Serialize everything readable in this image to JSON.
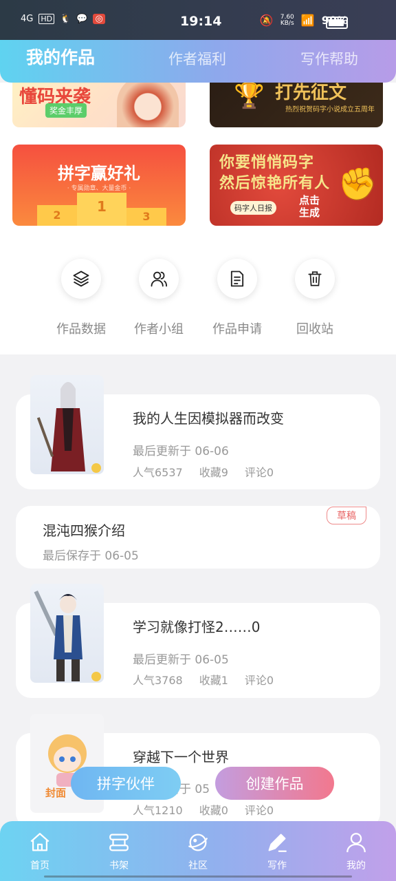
{
  "status_bar": {
    "time": "19:14",
    "network": "4G",
    "hd": "HD",
    "speed": "7.60",
    "speed_unit": "KB/s",
    "battery": "90%"
  },
  "header": {
    "tabs": [
      {
        "label": "我的作品"
      },
      {
        "label": "作者福利"
      },
      {
        "label": "写作帮助"
      }
    ]
  },
  "banners": {
    "b1": {
      "title": "懂码来袭",
      "badge": "奖金丰厚"
    },
    "b2": {
      "title": "打先征文",
      "sub": "热烈祝贺码字小说成立五周年"
    },
    "b3": {
      "title": "拼字赢好礼",
      "sub": "· 专属勋章、大量金币 ·",
      "podium": [
        "2",
        "1",
        "3"
      ]
    },
    "b4": {
      "title_line1": "你要悄悄码字",
      "title_line2": "然后惊艳所有人",
      "tag": "码字人日报",
      "cta_line1": "点击",
      "cta_line2": "生成"
    }
  },
  "shortcuts": [
    {
      "label": "作品数据",
      "icon": "layers-icon"
    },
    {
      "label": "作者小组",
      "icon": "group-icon"
    },
    {
      "label": "作品申请",
      "icon": "document-icon"
    },
    {
      "label": "回收站",
      "icon": "trash-icon"
    }
  ],
  "works": [
    {
      "title": "我的人生因模拟器而改变",
      "updated": "最后更新于 06-06",
      "popularity": "人气6537",
      "favorites": "收藏9",
      "comments": "评论0"
    },
    {
      "title": "混沌四猴介绍",
      "saved": "最后保存于 06-05",
      "tag": "草稿"
    },
    {
      "title": "学习就像打怪2……0",
      "updated": "最后更新于 06-05",
      "popularity": "人气3768",
      "favorites": "收藏1",
      "comments": "评论0"
    },
    {
      "title": "穿越下一个世界",
      "updated": "最后更新于 05",
      "popularity": "人气1210",
      "favorites": "收藏0",
      "comments": "评论0",
      "cover_text": "封面"
    }
  ],
  "floating": {
    "partner": "拼字伙伴",
    "create": "创建作品"
  },
  "bottom_nav": [
    {
      "label": "首页",
      "icon": "home-icon"
    },
    {
      "label": "书架",
      "icon": "bookshelf-icon"
    },
    {
      "label": "社区",
      "icon": "planet-icon"
    },
    {
      "label": "写作",
      "icon": "pen-icon"
    },
    {
      "label": "我的",
      "icon": "user-icon"
    }
  ],
  "colors": {
    "accent_blue": "#5fd3f0",
    "accent_purple": "#b79ce8",
    "draft_red": "#e86565"
  }
}
